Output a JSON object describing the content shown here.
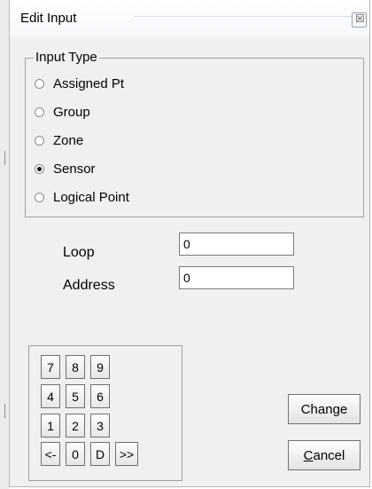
{
  "window": {
    "title": "Edit Input",
    "close_glyph": "☒",
    "close_icon": "close-icon"
  },
  "input_type": {
    "legend": "Input Type",
    "options": [
      {
        "label": "Assigned Pt",
        "checked": false
      },
      {
        "label": "Group",
        "checked": false
      },
      {
        "label": "Zone",
        "checked": false
      },
      {
        "label": "Sensor",
        "checked": true
      },
      {
        "label": "Logical Point",
        "checked": false
      }
    ]
  },
  "fields": {
    "loop": {
      "label": "Loop",
      "value": "0"
    },
    "address": {
      "label": "Address",
      "value": "0"
    }
  },
  "keypad": {
    "rows": [
      [
        "7",
        "8",
        "9"
      ],
      [
        "4",
        "5",
        "6"
      ],
      [
        "1",
        "2",
        "3"
      ],
      [
        "<-",
        "0",
        "D",
        ">>"
      ]
    ]
  },
  "buttons": {
    "change": {
      "label": "Change",
      "accel_before": "Chan",
      "accel": "g",
      "accel_after": "e"
    },
    "cancel": {
      "label": "Cancel",
      "accel_before": "",
      "accel": "C",
      "accel_after": "ancel"
    }
  }
}
